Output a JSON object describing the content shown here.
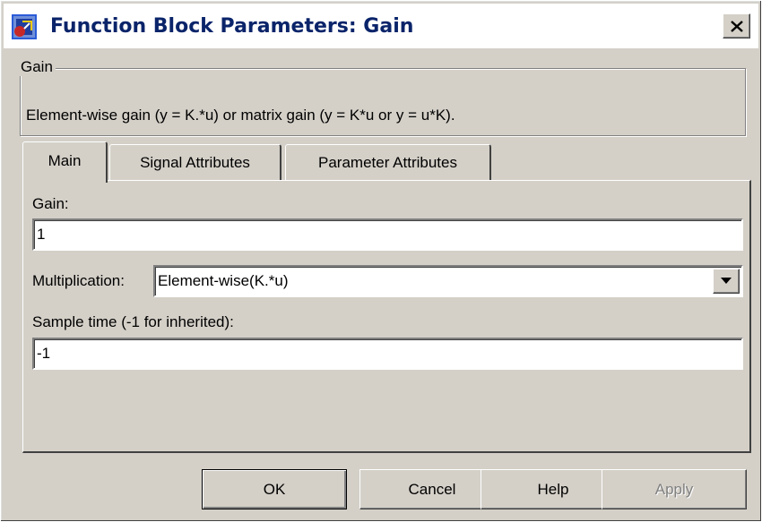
{
  "window": {
    "title": "Function Block Parameters: Gain",
    "icon": "simulink-block-icon",
    "close_icon": "close-icon"
  },
  "group": {
    "legend": "Gain",
    "description": "Element-wise gain (y = K.*u) or matrix gain (y = K*u or y = u*K)."
  },
  "tabs": [
    {
      "label": "Main",
      "active": true
    },
    {
      "label": "Signal Attributes",
      "active": false
    },
    {
      "label": "Parameter Attributes",
      "active": false
    }
  ],
  "main": {
    "gain_label": "Gain:",
    "gain_value": "1",
    "multiplication_label": "Multiplication:",
    "multiplication_value": "Element-wise(K.*u)",
    "sample_time_label": "Sample time (-1 for inherited):",
    "sample_time_value": "-1"
  },
  "buttons": {
    "ok": "OK",
    "cancel": "Cancel",
    "help": "Help",
    "apply": "Apply"
  },
  "colors": {
    "title_text": "#0a246a",
    "dialog_face": "#d4d0c8",
    "disabled_text": "#808080"
  }
}
